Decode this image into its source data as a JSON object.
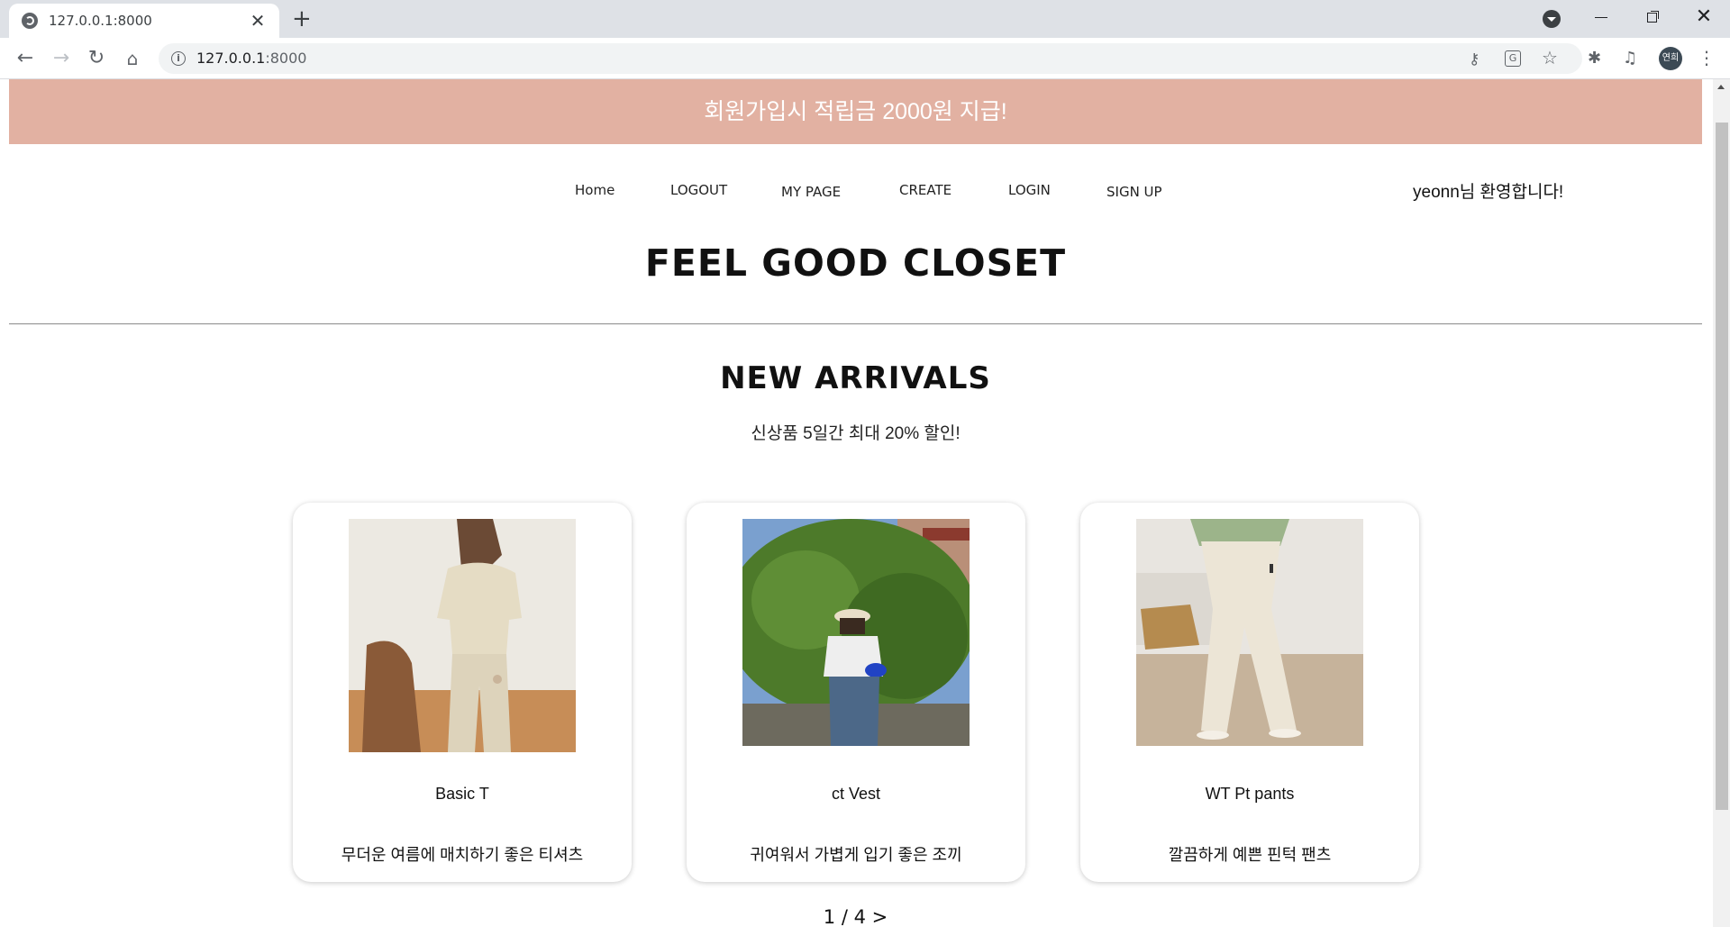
{
  "browser": {
    "tab_title": "127.0.0.1:8000",
    "url_host": "127.0.0.1",
    "url_port": ":8000",
    "profile_initials": "연희"
  },
  "banner": {
    "text": "회원가입시 적립금 2000원 지급!",
    "color": "#e2b1a2"
  },
  "nav": {
    "home": "Home",
    "logout": "LOGOUT",
    "mypage": "MY PAGE",
    "create": "CREATE",
    "login": "LOGIN",
    "signup": "SIGN UP"
  },
  "welcome": "yeonn님 환영합니다!",
  "brand": "FEEL GOOD CLOSET",
  "section": {
    "title": "NEW ARRIVALS",
    "subtitle": "신상품 5일간 최대 20% 할인!"
  },
  "products": [
    {
      "name": "Basic T",
      "desc": "무더운 여름에 매치하기 좋은 티셔츠"
    },
    {
      "name": "ct Vest",
      "desc": "귀여워서 가볍게 입기 좋은 조끼"
    },
    {
      "name": "WT Pt pants",
      "desc": "깔끔하게 예쁜 핀턱 팬츠"
    }
  ],
  "pager": "1 / 4 >"
}
